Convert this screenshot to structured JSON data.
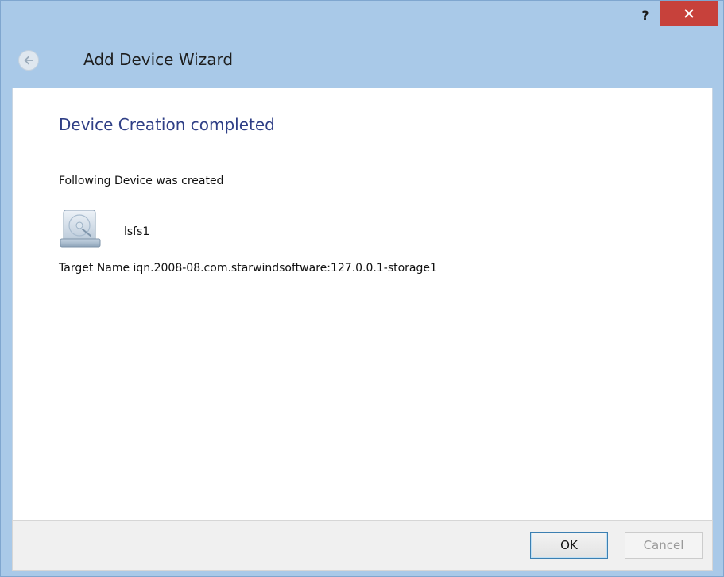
{
  "titlebar": {
    "help_label": "?",
    "close_icon": "close-icon"
  },
  "header": {
    "back_icon": "back-arrow-icon",
    "title": "Add Device Wizard"
  },
  "content": {
    "heading": "Device Creation completed",
    "description": "Following Device was created",
    "device": {
      "icon": "hard-disk-icon",
      "name": "lsfs1"
    },
    "target_line": "Target Name iqn.2008-08.com.starwindsoftware:127.0.0.1-storage1"
  },
  "footer": {
    "ok_label": "OK",
    "cancel_label": "Cancel"
  },
  "colors": {
    "frame": "#a9c9e8",
    "close_button": "#c7413b",
    "heading": "#2f3f86",
    "default_button_border": "#3c7fb1"
  }
}
